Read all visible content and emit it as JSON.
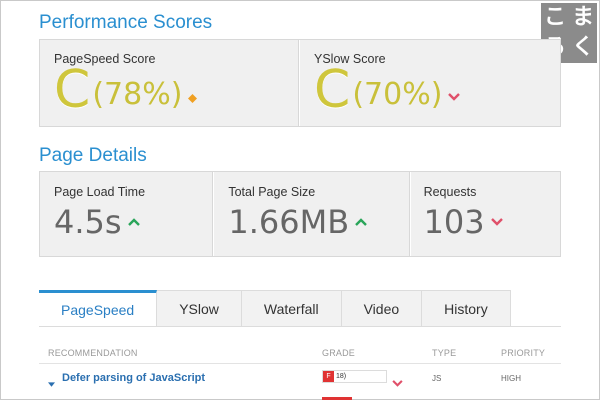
{
  "sections": {
    "performance_title": "Performance Scores",
    "details_title": "Page Details"
  },
  "scores": [
    {
      "label": "PageSpeed Score",
      "grade": "C",
      "percent": "(78%)",
      "trend": "neutral",
      "trend_icon": "diamond-icon",
      "trend_color": "#f0a022"
    },
    {
      "label": "YSlow Score",
      "grade": "C",
      "percent": "(70%)",
      "trend": "down",
      "trend_icon": "chevron-down-icon",
      "trend_color": "#e0506a"
    }
  ],
  "details": [
    {
      "label": "Page Load Time",
      "value": "4.5s",
      "trend": "up",
      "trend_icon": "chevron-up-icon",
      "trend_color": "#2aa55a"
    },
    {
      "label": "Total Page Size",
      "value": "1.66MB",
      "trend": "up",
      "trend_icon": "chevron-up-icon",
      "trend_color": "#2aa55a"
    },
    {
      "label": "Requests",
      "value": "103",
      "trend": "down",
      "trend_icon": "chevron-down-icon",
      "trend_color": "#e0506a"
    }
  ],
  "logo": {
    "chars": [
      "こ",
      "ま",
      "ろ",
      "く"
    ]
  },
  "tabs": [
    {
      "label": "PageSpeed",
      "active": true
    },
    {
      "label": "YSlow",
      "active": false
    },
    {
      "label": "Waterfall",
      "active": false
    },
    {
      "label": "Video",
      "active": false
    },
    {
      "label": "History",
      "active": false
    }
  ],
  "table": {
    "headers": {
      "recommendation": "RECOMMENDATION",
      "grade": "GRADE",
      "type": "TYPE",
      "priority": "PRIORITY"
    },
    "rows": [
      {
        "recommendation": "Defer parsing of JavaScript",
        "grade_letter": "F",
        "grade_score": "18)",
        "type": "JS",
        "priority": "HIGH"
      }
    ]
  },
  "colors": {
    "accent": "#2a8fd0",
    "grade_c": "#cfc63c",
    "grade_f": "#e03333"
  }
}
